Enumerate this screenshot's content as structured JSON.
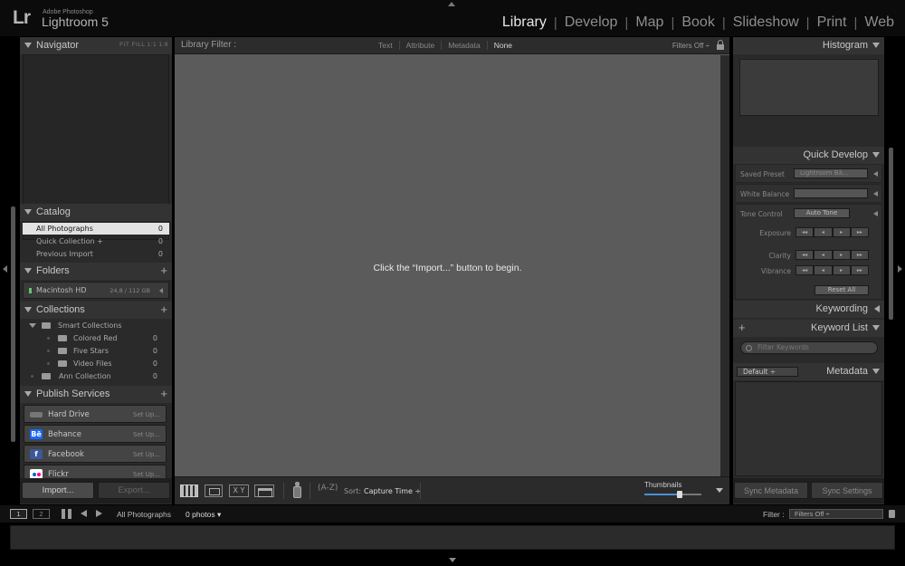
{
  "brand": {
    "logo": "Lr",
    "subtitle": "Adobe Photoshop",
    "name": "Lightroom 5"
  },
  "modules": [
    "Library",
    "Develop",
    "Map",
    "Book",
    "Slideshow",
    "Print",
    "Web"
  ],
  "active_module": "Library",
  "left_panel": {
    "navigator": {
      "title": "Navigator",
      "zoom_options": "FIT   FILL   1:1   1:8"
    },
    "catalog": {
      "title": "Catalog",
      "items": [
        {
          "label": "All Photographs",
          "count": "0"
        },
        {
          "label": "Quick Collection +",
          "count": "0"
        },
        {
          "label": "Previous Import",
          "count": "0"
        }
      ]
    },
    "folders": {
      "title": "Folders",
      "drive": "Macintosh HD",
      "size": "24,8 / 112 GB"
    },
    "collections": {
      "title": "Collections",
      "items": [
        {
          "label": "Smart Collections",
          "count": ""
        },
        {
          "label": "Colored Red",
          "count": "0"
        },
        {
          "label": "Five Stars",
          "count": "0"
        },
        {
          "label": "Video Files",
          "count": "0"
        },
        {
          "label": "Ann Collection",
          "count": "0"
        }
      ]
    },
    "publish": {
      "title": "Publish Services",
      "services": [
        {
          "name": "Hard Drive",
          "action": "Set Up..."
        },
        {
          "name": "Behance",
          "action": "Set Up..."
        },
        {
          "name": "Facebook",
          "action": "Set Up..."
        },
        {
          "name": "Flickr",
          "action": "Set Up..."
        }
      ]
    },
    "buttons": {
      "import": "Import...",
      "export": "Export..."
    }
  },
  "filter_bar": {
    "title": "Library Filter :",
    "tabs": [
      "Text",
      "Attribute",
      "Metadata",
      "None"
    ],
    "active_tab": "None",
    "status": "Filters Off ÷"
  },
  "center": {
    "empty_message": "Click the “Import...” button to begin."
  },
  "toolbar": {
    "compare_label": "X Y",
    "sort_icon": "(A-Z)",
    "sort_label": "Sort:",
    "sort_value": "Capture Time ÷",
    "thumbnails_label": "Thumbnails",
    "thumbnail_size_fraction": 0.62
  },
  "right_panel": {
    "histogram": "Histogram",
    "quick_develop": {
      "title": "Quick Develop",
      "saved_preset_label": "Saved Preset",
      "saved_preset_value": "Lightroom Bā...",
      "white_balance_label": "White Balance",
      "tone_control_label": "Tone Control",
      "auto_tone": "Auto Tone",
      "exposure_label": "Exposure",
      "clarity_label": "Clarity",
      "vibrance_label": "Vibrance",
      "reset_all": "Reset All",
      "step_buttons": [
        "◂◂",
        "◂",
        "▸",
        "▸▸"
      ]
    },
    "keywording": "Keywording",
    "keyword_list": {
      "title": "Keyword List",
      "placeholder": "Filter Keywords"
    },
    "metadata": {
      "title": "Metadata",
      "preset": "Default ÷"
    },
    "buttons": {
      "sync_metadata": "Sync Metadata",
      "sync_settings": "Sync Settings"
    }
  },
  "filmstrip": {
    "screens": [
      "1",
      "2"
    ],
    "source": "All Photographs",
    "count": "0 photos ▾",
    "filter_label": "Filter :",
    "filter_value": "Filters Off ÷"
  },
  "colors": {
    "behance": "#1769ff",
    "facebook": "#3b5998",
    "flickr_pink": "#ff0084",
    "thumb_slider": "#4a8fd9"
  }
}
